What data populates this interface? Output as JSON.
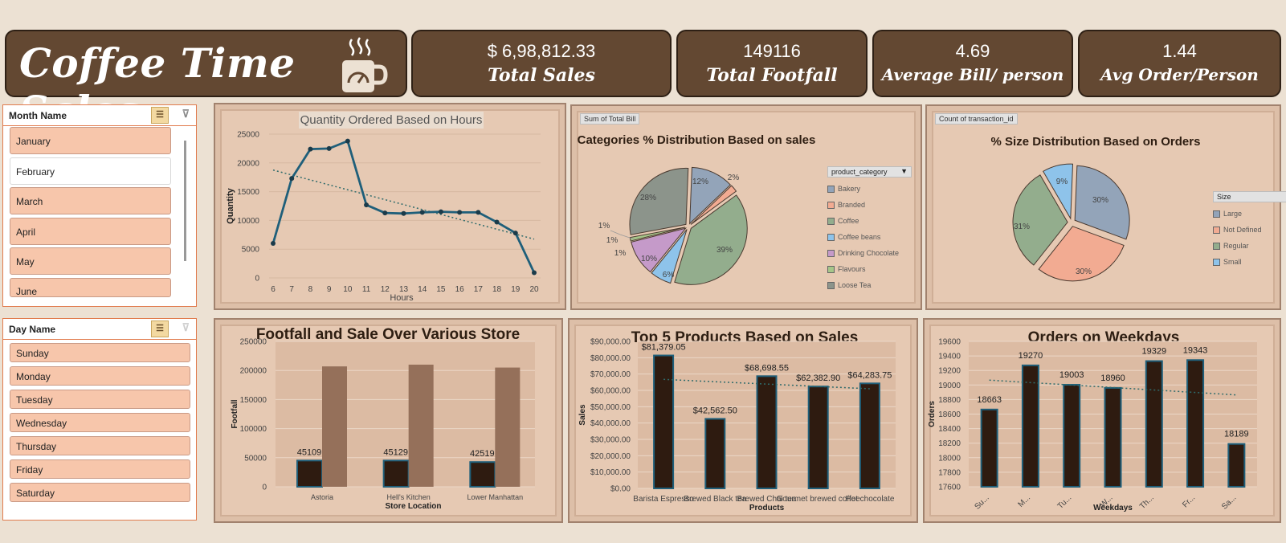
{
  "header": {
    "title": "Coffee Time Sales",
    "kpis": [
      {
        "value": "$ 6,98,812.33",
        "label": "Total Sales"
      },
      {
        "value": "149116",
        "label": "Total Footfall"
      },
      {
        "value": "4.69",
        "label": "Average Bill/ person"
      },
      {
        "value": "1.44",
        "label": "Avg Order/Person"
      }
    ]
  },
  "month_slicer": {
    "title": "Month Name",
    "items": [
      {
        "label": "January",
        "selected": true
      },
      {
        "label": "February",
        "selected": false
      },
      {
        "label": "March",
        "selected": true
      },
      {
        "label": "April",
        "selected": true
      },
      {
        "label": "May",
        "selected": true
      },
      {
        "label": "June",
        "selected": true
      }
    ]
  },
  "day_slicer": {
    "title": "Day Name",
    "items": [
      "Sunday",
      "Monday",
      "Tuesday",
      "Wednesday",
      "Thursday",
      "Friday",
      "Saturday"
    ]
  },
  "chart_data": [
    {
      "type": "line",
      "title": "Quantity Ordered Based on Hours",
      "xlabel": "Hours",
      "ylabel": "Quantity",
      "x": [
        6,
        7,
        8,
        9,
        10,
        11,
        12,
        13,
        14,
        15,
        16,
        17,
        18,
        19,
        20
      ],
      "values": [
        6000,
        17300,
        22400,
        22500,
        23800,
        12700,
        11300,
        11200,
        11400,
        11500,
        11400,
        11400,
        9700,
        7800,
        900
      ],
      "yticks": [
        0,
        5000,
        10000,
        15000,
        20000,
        25000
      ],
      "ylim": [
        0,
        25000
      ],
      "trendline": "linear",
      "color": "#1f5f7a"
    },
    {
      "type": "pie",
      "title": "Categories % Distribution Based on sales",
      "field_tag": "Sum of Total Bill",
      "legend_title": "product_category",
      "categories": [
        "Bakery",
        "Branded",
        "Coffee",
        "Coffee beans",
        "Drinking Chocolate",
        "Flavours",
        "Loose Tea"
      ],
      "values": [
        12,
        2,
        39,
        6,
        10,
        1,
        28
      ],
      "labels": [
        "12%",
        "2%",
        "39%",
        "6%",
        "10%",
        "1%",
        "28%"
      ],
      "extra_labels": [
        "1%",
        "1%",
        "1%"
      ],
      "colors": [
        "#93a4b9",
        "#f2ab92",
        "#93ad8d",
        "#8ec3ea",
        "#c59ac9",
        "#a6c689",
        "#8c948b"
      ],
      "legend_position": "right"
    },
    {
      "type": "pie",
      "title": "% Size Distribution Based on Orders",
      "field_tag": "Count of transaction_id",
      "legend_title": "Size",
      "categories": [
        "Large",
        "Not Defined",
        "Regular",
        "Small"
      ],
      "values": [
        30,
        30,
        31,
        9
      ],
      "labels": [
        "30%",
        "30%",
        "31%",
        "9%"
      ],
      "colors": [
        "#93a4b9",
        "#f2ab92",
        "#93ad8d",
        "#8ec3ea"
      ],
      "legend_position": "right"
    },
    {
      "type": "bar",
      "title": "Footfall and Sale Over Various Store Location",
      "xlabel": "Store Location",
      "ylabel": "Footfall",
      "categories": [
        "Astoria",
        "Hell's Kitchen",
        "Lower Manhattan"
      ],
      "series": [
        {
          "values": [
            45109,
            45129,
            42519
          ],
          "labels": [
            "45109",
            "45129",
            "42519"
          ],
          "color": "#2e1b10"
        },
        {
          "values": [
            207000,
            210000,
            205000
          ],
          "color": "#95705a"
        }
      ],
      "yticks": [
        "0",
        "50000",
        "100000",
        "150000",
        "200000",
        "250000"
      ],
      "ylim": [
        0,
        250000
      ]
    },
    {
      "type": "bar",
      "title": "Top 5  Products Based on Sales",
      "xlabel": "Products",
      "ylabel": "Sales",
      "categories": [
        "Barista Espresso",
        "Brewed Black tea",
        "Brewed Chai tea",
        "Gourmet brewed coffee",
        "Hot chocolate"
      ],
      "values": [
        81379.05,
        42562.5,
        68698.55,
        62382.9,
        64283.75
      ],
      "labels": [
        "$81,379.05",
        "$42,562.50",
        "$68,698.55",
        "$62,382.90",
        "$64,283.75"
      ],
      "yticks": [
        "$0.00",
        "$10,000.00",
        "$20,000.00",
        "$30,000.00",
        "$40,000.00",
        "$50,000.00",
        "$60,000.00",
        "$70,000.00",
        "$80,000.00",
        "$90,000.00"
      ],
      "ylim": [
        0,
        90000
      ],
      "trendline": "linear",
      "color": "#2e1b10",
      "border_color": "#1f5f7a"
    },
    {
      "type": "bar",
      "title": "Orders on Weekdays",
      "xlabel": "Weekdays",
      "ylabel": "Orders",
      "categories": [
        "Su...",
        "M...",
        "Tu...",
        "W...",
        "Th...",
        "Fr...",
        "Sa..."
      ],
      "values": [
        18663,
        19270,
        19003,
        18960,
        19329,
        19343,
        18189
      ],
      "labels": [
        "18663",
        "19270",
        "19003",
        "18960",
        "19329",
        "19343",
        "18189"
      ],
      "yticks": [
        "17600",
        "17800",
        "18000",
        "18200",
        "18400",
        "18600",
        "18800",
        "19000",
        "19200",
        "19400",
        "19600"
      ],
      "ylim": [
        17600,
        19600
      ],
      "trendline": "linear",
      "color": "#2e1b10",
      "border_color": "#1f5f7a"
    }
  ]
}
